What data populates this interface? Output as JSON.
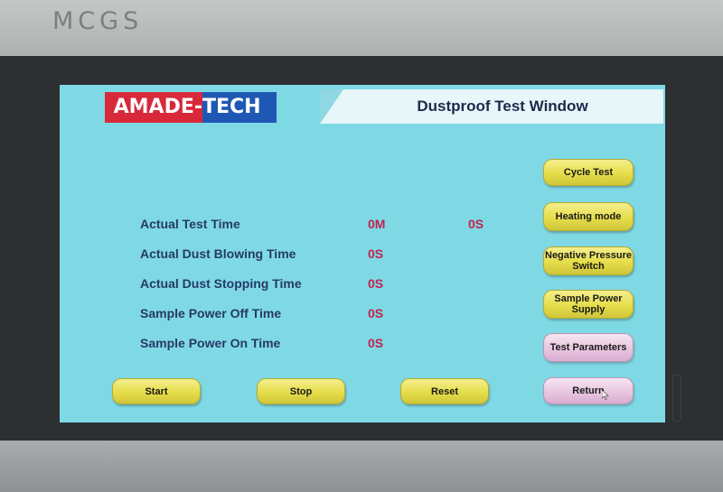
{
  "device": {
    "brand": "MCGS"
  },
  "header": {
    "logo_left": "AMADE-",
    "logo_right": "TECH",
    "title": "Dustproof Test Window"
  },
  "readings": [
    {
      "label": "Actual Test Time",
      "value": "0M",
      "value2": "0S"
    },
    {
      "label": "Actual Dust Blowing Time",
      "value": "0S"
    },
    {
      "label": "Actual Dust Stopping Time",
      "value": "0S"
    },
    {
      "label": "Sample Power Off Time",
      "value": "0S"
    },
    {
      "label": "Sample Power On Time",
      "value": "0S"
    }
  ],
  "side_buttons": {
    "cycle_test": "Cycle Test",
    "heating_mode": "Heating mode",
    "negative_pressure": "Negative Pressure Switch",
    "sample_power_supply": "Sample Power Supply",
    "test_parameters": "Test Parameters",
    "return": "Return"
  },
  "bottom_buttons": {
    "start": "Start",
    "stop": "Stop",
    "reset": "Reset"
  },
  "colors": {
    "screen": "#7fd9e5",
    "button_yellow": "#e6dd4a",
    "button_pink": "#e7c3dd",
    "value_red": "#c2234e",
    "label_navy": "#263a66"
  }
}
